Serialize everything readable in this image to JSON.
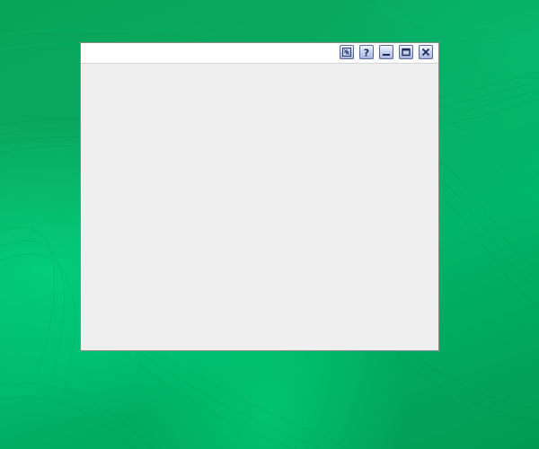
{
  "window": {
    "title": "",
    "controls": [
      {
        "name": "shade-button",
        "icon": "shade-icon"
      },
      {
        "name": "help-button",
        "icon": "help-icon"
      },
      {
        "name": "minimize-button",
        "icon": "minimize-icon"
      },
      {
        "name": "maximize-button",
        "icon": "maximize-icon"
      },
      {
        "name": "close-button",
        "icon": "close-icon"
      }
    ]
  },
  "colors": {
    "desktop": "#0aa862",
    "window_bg": "#efefef",
    "titlebar_bg": "#ffffff",
    "button_border": "#5a6a95"
  }
}
